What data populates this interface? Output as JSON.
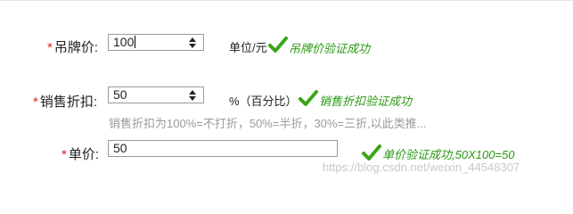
{
  "form": {
    "tag_price": {
      "required_mark": "*",
      "label": "吊牌价:",
      "value": "100",
      "unit": "单位/元",
      "success_msg": "吊牌价验证成功"
    },
    "discount": {
      "required_mark": "*",
      "label": "销售折扣:",
      "value": "50",
      "unit": "%（百分比）",
      "success_msg": "销售折扣验证成功",
      "hint": "销售折扣为100%=不打折，50%=半折，30%=三折,以此类推..."
    },
    "unit_price": {
      "required_mark": "*",
      "label": "单价:",
      "value": "50",
      "success_msg": "单价验证成功,50X100=50"
    }
  },
  "watermark": "https://blog.csdn.net/weixin_44548307",
  "colors": {
    "required": "#e02020",
    "success": "#2a9a14",
    "hint": "#9a9a9a"
  },
  "icons": {
    "success": "check-icon",
    "spinner": "spinner-arrows-icon"
  }
}
